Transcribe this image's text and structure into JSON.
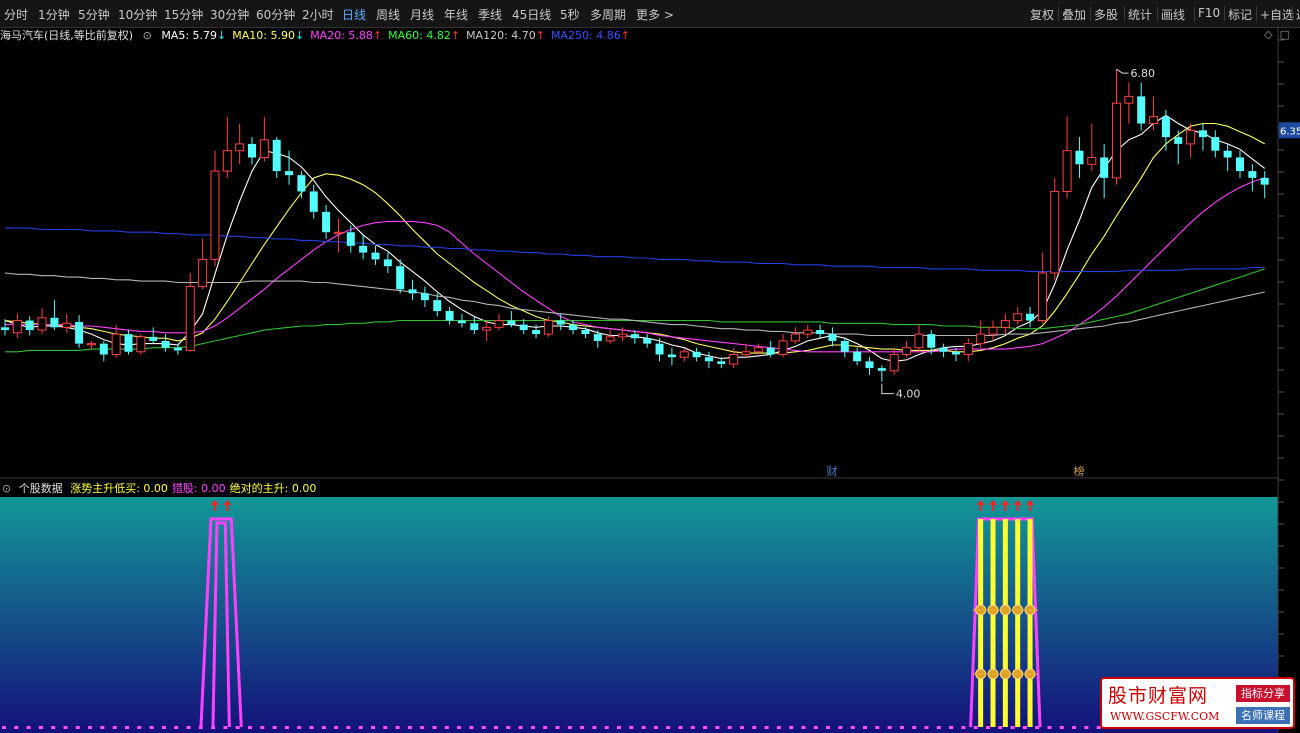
{
  "toolbar": {
    "periods": [
      "分时",
      "1分钟",
      "5分钟",
      "10分钟",
      "15分钟",
      "30分钟",
      "60分钟",
      "2小时",
      "日线",
      "周线",
      "月线",
      "年线",
      "季线",
      "45日线",
      "5秒",
      "多周期",
      "更多 >"
    ],
    "active_period": "日线",
    "right_tools": [
      "复权",
      "叠加",
      "多股",
      "统计",
      "画线",
      "F10",
      "标记",
      "+自选",
      "返"
    ]
  },
  "main_panel": {
    "title": "海马汽车(日线,等比前复权)",
    "ma_legend": [
      {
        "label": "MA5: 5.79",
        "arrow": "↓",
        "color": "#ffffff",
        "arrow_color": "#00ffff"
      },
      {
        "label": "MA10: 5.90",
        "arrow": "↓",
        "color": "#ffff60",
        "arrow_color": "#00ffff"
      },
      {
        "label": "MA20: 5.88",
        "arrow": "↑",
        "color": "#ff40ff",
        "arrow_color": "#ff3030"
      },
      {
        "label": "MA60: 4.82",
        "arrow": "↑",
        "color": "#30ff30",
        "arrow_color": "#ff3030"
      },
      {
        "label": "MA120: 4.70",
        "arrow": "↑",
        "color": "#c8c8c8",
        "arrow_color": "#ff3030"
      },
      {
        "label": "MA250: 4.86",
        "arrow": "↑",
        "color": "#3050ff",
        "arrow_color": "#ff3030"
      }
    ],
    "high_label": "6.80",
    "low_label": "4.00",
    "price_tag": "6.35",
    "event_labels": [
      "财",
      "榜"
    ]
  },
  "sub_panel": {
    "title": "个股数据",
    "legend": [
      {
        "label": "涨势主升低买: 0.00",
        "color": "#ffff40"
      },
      {
        "label": "猎股: 0.00",
        "color": "#ff40ff"
      },
      {
        "label": "绝对的主升: 0.00",
        "color": "#ffff40"
      }
    ]
  },
  "watermark": {
    "title": "股市财富网",
    "url": "WWW.GSCFW.COM",
    "tag1": "指标分享",
    "tag2": "名师课程"
  },
  "colors": {
    "up": "#ff4040",
    "down": "#54ffff",
    "ma5": "#ffffff",
    "ma10": "#ffff60",
    "ma20": "#ff40ff",
    "ma60": "#30c030",
    "ma120": "#b4b4b4",
    "ma250": "#2040e0",
    "signal": "#ff40ff",
    "bar": "#ffff30"
  },
  "chart_data": {
    "type": "candlestick",
    "y_range": [
      3.85,
      7.0
    ],
    "candles": [
      [
        4.9,
        4.88,
        4.96,
        4.84
      ],
      [
        4.86,
        4.95,
        5.0,
        4.82
      ],
      [
        4.95,
        4.88,
        4.98,
        4.84
      ],
      [
        4.88,
        4.97,
        5.04,
        4.85
      ],
      [
        4.97,
        4.9,
        5.1,
        4.88
      ],
      [
        4.9,
        4.93,
        5.0,
        4.86
      ],
      [
        4.94,
        4.78,
        4.99,
        4.75
      ],
      [
        4.78,
        4.78,
        4.8,
        4.74
      ],
      [
        4.78,
        4.7,
        4.8,
        4.65
      ],
      [
        4.7,
        4.85,
        4.92,
        4.68
      ],
      [
        4.85,
        4.72,
        4.88,
        4.7
      ],
      [
        4.72,
        4.83,
        4.85,
        4.7
      ],
      [
        4.83,
        4.8,
        4.9,
        4.78
      ],
      [
        4.8,
        4.75,
        4.85,
        4.72
      ],
      [
        4.75,
        4.73,
        4.78,
        4.7
      ],
      [
        4.73,
        5.2,
        5.3,
        4.72
      ],
      [
        5.2,
        5.4,
        5.55,
        5.18
      ],
      [
        5.4,
        6.05,
        6.2,
        5.35
      ],
      [
        6.05,
        6.2,
        6.45,
        6.0
      ],
      [
        6.2,
        6.25,
        6.4,
        6.1
      ],
      [
        6.25,
        6.15,
        6.3,
        6.1
      ],
      [
        6.15,
        6.28,
        6.45,
        6.12
      ],
      [
        6.28,
        6.05,
        6.3,
        6.0
      ],
      [
        6.05,
        6.02,
        6.2,
        5.95
      ],
      [
        6.02,
        5.9,
        6.05,
        5.85
      ],
      [
        5.9,
        5.75,
        5.95,
        5.7
      ],
      [
        5.75,
        5.6,
        5.8,
        5.55
      ],
      [
        5.6,
        5.6,
        5.7,
        5.45
      ],
      [
        5.6,
        5.5,
        5.65,
        5.45
      ],
      [
        5.5,
        5.45,
        5.58,
        5.4
      ],
      [
        5.45,
        5.4,
        5.5,
        5.36
      ],
      [
        5.4,
        5.35,
        5.45,
        5.3
      ],
      [
        5.35,
        5.18,
        5.4,
        5.15
      ],
      [
        5.18,
        5.15,
        5.25,
        5.1
      ],
      [
        5.15,
        5.1,
        5.2,
        5.05
      ],
      [
        5.1,
        5.02,
        5.15,
        4.98
      ],
      [
        5.02,
        4.95,
        5.05,
        4.92
      ],
      [
        4.95,
        4.93,
        5.0,
        4.9
      ],
      [
        4.93,
        4.88,
        4.98,
        4.85
      ],
      [
        4.88,
        4.9,
        4.95,
        4.8
      ],
      [
        4.9,
        4.95,
        5.0,
        4.88
      ],
      [
        4.95,
        4.92,
        5.02,
        4.9
      ],
      [
        4.92,
        4.88,
        4.96,
        4.85
      ],
      [
        4.88,
        4.85,
        4.92,
        4.82
      ],
      [
        4.85,
        4.95,
        4.98,
        4.83
      ],
      [
        4.95,
        4.92,
        5.0,
        4.88
      ],
      [
        4.92,
        4.88,
        4.95,
        4.85
      ],
      [
        4.88,
        4.85,
        4.9,
        4.82
      ],
      [
        4.85,
        4.8,
        4.88,
        4.75
      ],
      [
        4.8,
        4.83,
        4.88,
        4.78
      ],
      [
        4.83,
        4.85,
        4.9,
        4.8
      ],
      [
        4.85,
        4.82,
        4.88,
        4.78
      ],
      [
        4.82,
        4.78,
        4.85,
        4.75
      ],
      [
        4.78,
        4.7,
        4.82,
        4.65
      ],
      [
        4.7,
        4.68,
        4.75,
        4.62
      ],
      [
        4.68,
        4.72,
        4.75,
        4.65
      ],
      [
        4.72,
        4.68,
        4.75,
        4.65
      ],
      [
        4.68,
        4.65,
        4.72,
        4.6
      ],
      [
        4.65,
        4.63,
        4.68,
        4.6
      ],
      [
        4.63,
        4.7,
        4.75,
        4.6
      ],
      [
        4.7,
        4.72,
        4.78,
        4.68
      ],
      [
        4.72,
        4.75,
        4.78,
        4.7
      ],
      [
        4.75,
        4.7,
        4.8,
        4.68
      ],
      [
        4.7,
        4.8,
        4.85,
        4.68
      ],
      [
        4.8,
        4.85,
        4.9,
        4.78
      ],
      [
        4.85,
        4.88,
        4.92,
        4.82
      ],
      [
        4.88,
        4.85,
        4.92,
        4.82
      ],
      [
        4.85,
        4.8,
        4.9,
        4.76
      ],
      [
        4.8,
        4.72,
        4.82,
        4.68
      ],
      [
        4.72,
        4.65,
        4.75,
        4.62
      ],
      [
        4.65,
        4.6,
        4.68,
        4.55
      ],
      [
        4.6,
        4.58,
        4.62,
        4.5
      ],
      [
        4.58,
        4.7,
        4.75,
        4.55
      ],
      [
        4.7,
        4.75,
        4.8,
        4.68
      ],
      [
        4.75,
        4.85,
        4.92,
        4.72
      ],
      [
        4.85,
        4.75,
        4.88,
        4.7
      ],
      [
        4.75,
        4.72,
        4.78,
        4.68
      ],
      [
        4.72,
        4.7,
        4.75,
        4.65
      ],
      [
        4.7,
        4.78,
        4.82,
        4.65
      ],
      [
        4.78,
        4.85,
        4.95,
        4.75
      ],
      [
        4.85,
        4.9,
        4.95,
        4.8
      ],
      [
        4.9,
        4.95,
        5.0,
        4.85
      ],
      [
        4.95,
        5.0,
        5.05,
        4.92
      ],
      [
        5.0,
        4.95,
        5.05,
        4.9
      ],
      [
        4.95,
        5.3,
        5.45,
        4.93
      ],
      [
        5.3,
        5.9,
        6.0,
        5.25
      ],
      [
        5.9,
        6.2,
        6.45,
        5.85
      ],
      [
        6.2,
        6.1,
        6.3,
        6.0
      ],
      [
        6.1,
        6.15,
        6.4,
        6.05
      ],
      [
        6.15,
        6.0,
        6.25,
        5.85
      ],
      [
        6.0,
        6.55,
        6.8,
        5.95
      ],
      [
        6.55,
        6.6,
        6.7,
        6.4
      ],
      [
        6.6,
        6.4,
        6.7,
        6.35
      ],
      [
        6.4,
        6.45,
        6.6,
        6.35
      ],
      [
        6.45,
        6.3,
        6.5,
        6.2
      ],
      [
        6.3,
        6.25,
        6.35,
        6.1
      ],
      [
        6.25,
        6.35,
        6.4,
        6.15
      ],
      [
        6.35,
        6.3,
        6.4,
        6.2
      ],
      [
        6.3,
        6.2,
        6.35,
        6.15
      ],
      [
        6.2,
        6.15,
        6.25,
        6.05
      ],
      [
        6.15,
        6.05,
        6.2,
        6.0
      ],
      [
        6.05,
        6.0,
        6.1,
        5.9
      ],
      [
        6.0,
        5.95,
        6.05,
        5.85
      ]
    ],
    "ma_series": [
      {
        "name": "MA5",
        "values": [
          4.95,
          4.92,
          4.9,
          4.91,
          4.91,
          4.9,
          4.88,
          4.85,
          4.81,
          4.78,
          4.77,
          4.78,
          4.78,
          4.78,
          4.77,
          4.87,
          5.0,
          5.29,
          5.58,
          5.83,
          6.05,
          6.2,
          6.18,
          6.15,
          6.08,
          5.98,
          5.86,
          5.76,
          5.67,
          5.58,
          5.51,
          5.46,
          5.38,
          5.31,
          5.24,
          5.16,
          5.09,
          5.03,
          4.98,
          4.94,
          4.92,
          4.92,
          4.91,
          4.9,
          4.91,
          4.91,
          4.9,
          4.89,
          4.86,
          4.84,
          4.84,
          4.83,
          4.82,
          4.8,
          4.77,
          4.75,
          4.71,
          4.69,
          4.67,
          4.68,
          4.68,
          4.69,
          4.7,
          4.73,
          4.76,
          4.8,
          4.82,
          4.84,
          4.82,
          4.78,
          4.73,
          4.67,
          4.65,
          4.66,
          4.7,
          4.73,
          4.75,
          4.76,
          4.76,
          4.78,
          4.8,
          4.84,
          4.9,
          4.94,
          5.02,
          5.22,
          5.47,
          5.69,
          5.93,
          6.07,
          6.2,
          6.28,
          6.32,
          6.4,
          6.46,
          6.4,
          6.35,
          6.33,
          6.28,
          6.25,
          6.21,
          6.14,
          6.07
        ]
      },
      {
        "name": "MA10",
        "values": [
          4.95,
          4.94,
          4.93,
          4.92,
          4.92,
          4.91,
          4.9,
          4.89,
          4.87,
          4.85,
          4.84,
          4.83,
          4.82,
          4.82,
          4.8,
          4.82,
          4.86,
          4.96,
          5.09,
          5.23,
          5.37,
          5.51,
          5.64,
          5.77,
          5.89,
          6.0,
          6.03,
          6.02,
          5.99,
          5.95,
          5.89,
          5.81,
          5.72,
          5.62,
          5.53,
          5.44,
          5.37,
          5.3,
          5.23,
          5.17,
          5.11,
          5.06,
          5.02,
          4.98,
          4.95,
          4.94,
          4.92,
          4.91,
          4.9,
          4.89,
          4.88,
          4.87,
          4.86,
          4.85,
          4.83,
          4.81,
          4.78,
          4.76,
          4.74,
          4.72,
          4.71,
          4.71,
          4.71,
          4.71,
          4.72,
          4.73,
          4.75,
          4.77,
          4.77,
          4.76,
          4.75,
          4.74,
          4.74,
          4.73,
          4.73,
          4.73,
          4.73,
          4.72,
          4.72,
          4.73,
          4.75,
          4.78,
          4.82,
          4.85,
          4.91,
          5.02,
          5.15,
          5.29,
          5.44,
          5.57,
          5.72,
          5.86,
          6.0,
          6.15,
          6.25,
          6.32,
          6.38,
          6.4,
          6.4,
          6.38,
          6.34,
          6.3,
          6.25
        ]
      },
      {
        "name": "MA20",
        "values": [
          4.92,
          4.92,
          4.92,
          4.92,
          4.92,
          4.92,
          4.91,
          4.91,
          4.9,
          4.89,
          4.88,
          4.87,
          4.87,
          4.86,
          4.86,
          4.86,
          4.87,
          4.91,
          4.97,
          5.04,
          5.11,
          5.18,
          5.26,
          5.33,
          5.4,
          5.47,
          5.53,
          5.58,
          5.62,
          5.65,
          5.67,
          5.68,
          5.68,
          5.68,
          5.67,
          5.65,
          5.6,
          5.52,
          5.44,
          5.37,
          5.3,
          5.23,
          5.16,
          5.1,
          5.04,
          4.98,
          4.94,
          4.92,
          4.9,
          4.89,
          4.88,
          4.87,
          4.86,
          4.84,
          4.83,
          4.82,
          4.81,
          4.8,
          4.79,
          4.78,
          4.77,
          4.76,
          4.75,
          4.74,
          4.73,
          4.72,
          4.72,
          4.72,
          4.72,
          4.72,
          4.72,
          4.72,
          4.72,
          4.72,
          4.72,
          4.72,
          4.73,
          4.74,
          4.74,
          4.74,
          4.74,
          4.74,
          4.75,
          4.76,
          4.78,
          4.82,
          4.86,
          4.92,
          4.98,
          5.05,
          5.13,
          5.22,
          5.31,
          5.4,
          5.49,
          5.58,
          5.67,
          5.75,
          5.82,
          5.88,
          5.93,
          5.97,
          6.0
        ]
      },
      {
        "name": "MA60",
        "values": [
          4.72,
          4.72,
          4.73,
          4.73,
          4.73,
          4.73,
          4.73,
          4.74,
          4.74,
          4.74,
          4.74,
          4.74,
          4.75,
          4.75,
          4.75,
          4.76,
          4.78,
          4.8,
          4.82,
          4.84,
          4.86,
          4.88,
          4.89,
          4.9,
          4.91,
          4.91,
          4.92,
          4.92,
          4.93,
          4.93,
          4.94,
          4.94,
          4.95,
          4.95,
          4.95,
          4.95,
          4.95,
          4.95,
          4.95,
          4.95,
          4.95,
          4.95,
          4.95,
          4.95,
          4.95,
          4.95,
          4.95,
          4.95,
          4.95,
          4.95,
          4.95,
          4.95,
          4.95,
          4.95,
          4.95,
          4.95,
          4.95,
          4.95,
          4.94,
          4.94,
          4.94,
          4.94,
          4.94,
          4.94,
          4.94,
          4.94,
          4.94,
          4.93,
          4.93,
          4.93,
          4.93,
          4.93,
          4.92,
          4.92,
          4.92,
          4.92,
          4.91,
          4.91,
          4.91,
          4.9,
          4.9,
          4.9,
          4.89,
          4.89,
          4.89,
          4.9,
          4.91,
          4.92,
          4.94,
          4.96,
          4.98,
          5.0,
          5.03,
          5.06,
          5.09,
          5.12,
          5.15,
          5.18,
          5.21,
          5.24,
          5.27,
          5.3,
          5.33
        ]
      },
      {
        "name": "MA120",
        "values": [
          5.3,
          5.29,
          5.29,
          5.28,
          5.28,
          5.27,
          5.27,
          5.26,
          5.26,
          5.25,
          5.25,
          5.24,
          5.24,
          5.24,
          5.23,
          5.23,
          5.23,
          5.23,
          5.23,
          5.23,
          5.24,
          5.24,
          5.24,
          5.24,
          5.24,
          5.23,
          5.23,
          5.22,
          5.21,
          5.2,
          5.19,
          5.18,
          5.17,
          5.16,
          5.15,
          5.13,
          5.12,
          5.1,
          5.09,
          5.07,
          5.06,
          5.04,
          5.03,
          5.02,
          5.01,
          5.0,
          4.99,
          4.98,
          4.97,
          4.96,
          4.96,
          4.95,
          4.94,
          4.93,
          4.92,
          4.92,
          4.91,
          4.9,
          4.89,
          4.89,
          4.88,
          4.88,
          4.87,
          4.87,
          4.86,
          4.86,
          4.86,
          4.85,
          4.85,
          4.85,
          4.84,
          4.84,
          4.84,
          4.84,
          4.84,
          4.84,
          4.84,
          4.84,
          4.84,
          4.84,
          4.84,
          4.85,
          4.85,
          4.85,
          4.86,
          4.87,
          4.88,
          4.89,
          4.9,
          4.91,
          4.93,
          4.94,
          4.96,
          4.98,
          5.0,
          5.02,
          5.04,
          5.06,
          5.08,
          5.1,
          5.12,
          5.14,
          5.16
        ]
      },
      {
        "name": "MA250",
        "values": [
          5.63,
          5.63,
          5.63,
          5.62,
          5.62,
          5.62,
          5.62,
          5.61,
          5.61,
          5.61,
          5.6,
          5.6,
          5.6,
          5.59,
          5.59,
          5.58,
          5.58,
          5.58,
          5.57,
          5.57,
          5.56,
          5.56,
          5.55,
          5.55,
          5.54,
          5.54,
          5.53,
          5.53,
          5.52,
          5.52,
          5.51,
          5.51,
          5.5,
          5.5,
          5.49,
          5.49,
          5.48,
          5.48,
          5.47,
          5.47,
          5.46,
          5.46,
          5.45,
          5.45,
          5.44,
          5.44,
          5.43,
          5.43,
          5.42,
          5.42,
          5.42,
          5.41,
          5.41,
          5.4,
          5.4,
          5.4,
          5.39,
          5.39,
          5.38,
          5.38,
          5.38,
          5.37,
          5.37,
          5.37,
          5.36,
          5.36,
          5.36,
          5.35,
          5.35,
          5.35,
          5.35,
          5.34,
          5.34,
          5.34,
          5.34,
          5.33,
          5.33,
          5.33,
          5.33,
          5.32,
          5.32,
          5.32,
          5.32,
          5.31,
          5.31,
          5.31,
          5.31,
          5.31,
          5.31,
          5.31,
          5.31,
          5.32,
          5.32,
          5.32,
          5.32,
          5.32,
          5.33,
          5.33,
          5.33,
          5.33,
          5.33,
          5.34,
          5.34
        ]
      }
    ],
    "signals": {
      "peaks": [
        17,
        18
      ],
      "bars": [
        79,
        80,
        81,
        82,
        83
      ]
    }
  }
}
